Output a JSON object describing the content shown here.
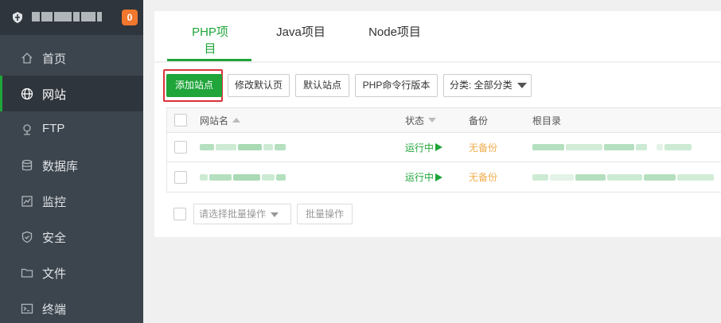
{
  "header": {
    "badge_count": "0"
  },
  "sidebar": {
    "items": [
      {
        "label": "首页",
        "icon": "home-icon"
      },
      {
        "label": "网站",
        "icon": "globe-icon",
        "active": true
      },
      {
        "label": "FTP",
        "icon": "ftp-icon"
      },
      {
        "label": "数据库",
        "icon": "database-icon"
      },
      {
        "label": "监控",
        "icon": "monitor-icon"
      },
      {
        "label": "安全",
        "icon": "shield-icon"
      },
      {
        "label": "文件",
        "icon": "folder-icon"
      },
      {
        "label": "终端",
        "icon": "terminal-icon"
      }
    ]
  },
  "tabs": [
    {
      "label": "PHP项目",
      "active": true
    },
    {
      "label": "Java项目"
    },
    {
      "label": "Node项目"
    }
  ],
  "toolbar": {
    "add_site": "添加站点",
    "edit_default_page": "修改默认页",
    "default_site": "默认站点",
    "php_cli_version": "PHP命令行版本",
    "category_select": "分类: 全部分类"
  },
  "table": {
    "headers": {
      "name": "网站名",
      "status": "状态",
      "backup": "备份",
      "root": "根目录"
    },
    "rows": [
      {
        "status": "运行中",
        "backup": "无备份"
      },
      {
        "status": "运行中",
        "backup": "无备份"
      }
    ]
  },
  "batch": {
    "select_placeholder": "请选择批量操作",
    "action_label": "批量操作"
  },
  "colors": {
    "accent": "#20a53a",
    "sidebar_bg": "#3c444d",
    "badge": "#f0772d",
    "warning": "#f0ad4e",
    "highlight": "#d9333a"
  }
}
